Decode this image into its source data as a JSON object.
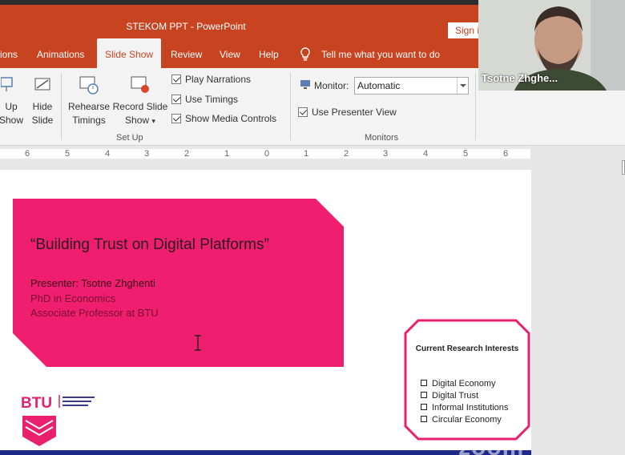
{
  "window": {
    "title": "STEKOM PPT  -  PowerPoint",
    "sign_in": "Sign in"
  },
  "tabs": [
    {
      "label": "ions"
    },
    {
      "label": "Animations"
    },
    {
      "label": "Slide Show",
      "active": true
    },
    {
      "label": "Review"
    },
    {
      "label": "View"
    },
    {
      "label": "Help"
    }
  ],
  "tell_me": "Tell me what you want to do",
  "ribbon": {
    "setup_show": [
      "Up",
      "Show"
    ],
    "hide_slide": [
      "Hide",
      "Slide"
    ],
    "rehearse": [
      "Rehearse",
      "Timings"
    ],
    "record": [
      "Record Slide",
      "Show"
    ],
    "play_narrations": "Play Narrations",
    "use_timings": "Use Timings",
    "show_media_controls": "Show Media Controls",
    "setup_label": "Set Up",
    "monitor_label": "Monitor:",
    "monitor_value": "Automatic",
    "presenter_view": "Use Presenter View",
    "monitors_label": "Monitors"
  },
  "ruler": {
    "ticks": [
      "6",
      "5",
      "4",
      "3",
      "2",
      "1",
      "0",
      "1",
      "2",
      "3",
      "4",
      "5",
      "6"
    ]
  },
  "slide": {
    "title": "“Building Trust on Digital Platforms”",
    "presenter": "Presenter: Tsotne Zhghenti",
    "degree": "PhD in Economics",
    "position": "Associate Professor at BTU",
    "interests_title": "Current Research Interests",
    "interests": [
      "Digital Economy",
      "Digital Trust",
      "Informal Institutions",
      "Circular Economy"
    ],
    "logo_text": "BTU",
    "pink_color": "#f01e6e"
  },
  "webcam": {
    "name": "Tsotne Zhghe..."
  },
  "watermark": "zoom",
  "colors": {
    "accent": "#c8431f"
  }
}
